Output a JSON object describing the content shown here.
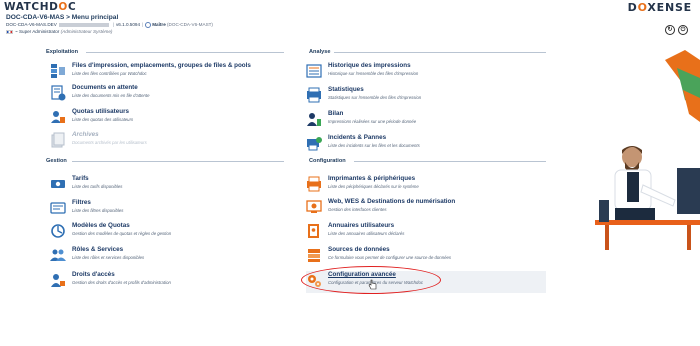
{
  "header": {
    "logo_left_a": "WATCHD",
    "logo_left_b": "O",
    "logo_left_c": "C",
    "logo_right_a": "D",
    "logo_right_b": "O",
    "logo_right_c": "XENSE",
    "breadcrumb": "DOC-CDA-V6-MAS > Menu principal",
    "server": "DOC-CDA-V6-MAS.DEV",
    "version": "v6.1.0.5094",
    "role": "Maître",
    "role_host": "(DOC-CDA-V6-MAST)",
    "user": "~ Super Administrator",
    "user_note": "(Administrateur Système)"
  },
  "sections": {
    "exploitation": "Exploitation",
    "gestion": "Gestion",
    "analyse": "Analyse",
    "configuration": "Configuration"
  },
  "exploitation": [
    {
      "title": "Files d'impression, emplacements, groupes de files & pools",
      "desc": "Liste des files contrôlées par Watchdoc",
      "icon": "printer-queue-icon"
    },
    {
      "title": "Documents en attente",
      "desc": "Liste des documents mis en file d'attente",
      "icon": "document-wait-icon"
    },
    {
      "title": "Quotas utilisateurs",
      "desc": "Liste des quotas des utilisateurs",
      "icon": "user-quota-icon"
    },
    {
      "title": "Archives",
      "desc": "Documents archivés par les utilisateurs",
      "icon": "archive-icon"
    }
  ],
  "gestion": [
    {
      "title": "Tarifs",
      "desc": "Liste des tarifs disponibles",
      "icon": "pricing-icon"
    },
    {
      "title": "Filtres",
      "desc": "Liste des filtres disponibles",
      "icon": "filter-icon"
    },
    {
      "title": "Modèles de Quotas",
      "desc": "Gestion des modèles de quotas et règles de gestion",
      "icon": "quota-model-icon"
    },
    {
      "title": "Rôles & Services",
      "desc": "Liste des rôles et services disponibles",
      "icon": "roles-icon"
    },
    {
      "title": "Droits d'accès",
      "desc": "Gestion des droits d'accès et profils d'administration",
      "icon": "access-rights-icon"
    }
  ],
  "analyse": [
    {
      "title": "Historique des impressions",
      "desc": "Historique sur l'ensemble des files d'impression",
      "icon": "history-icon"
    },
    {
      "title": "Statistiques",
      "desc": "Statistiques sur l'ensemble des files d'impression",
      "icon": "statistics-icon"
    },
    {
      "title": "Bilan",
      "desc": "Impressions réalisées sur une période donnée",
      "icon": "report-icon"
    },
    {
      "title": "Incidents & Pannes",
      "desc": "Liste des incidents sur les files et les documents",
      "icon": "incidents-icon"
    }
  ],
  "configuration": [
    {
      "title": "Imprimantes & périphériques",
      "desc": "Liste des périphériques déclarés sur le système",
      "icon": "printers-icon"
    },
    {
      "title": "Web, WES & Destinations de numérisation",
      "desc": "Gestion des interfaces clientes",
      "icon": "web-wes-icon"
    },
    {
      "title": "Annuaires utilisateurs",
      "desc": "Liste des annuaires utilisateurs déclarés",
      "icon": "directories-icon"
    },
    {
      "title": "Sources de données",
      "desc": "Ce formulaire vous permet de configurer une source de données",
      "icon": "data-sources-icon"
    },
    {
      "title": "Configuration avancée",
      "desc": "Configuration et paramètres du serveur Watchdoc",
      "icon": "advanced-config-icon"
    }
  ],
  "colors": {
    "accent": "#e8701a",
    "text": "#1d3a66",
    "highlight": "#e02020"
  }
}
